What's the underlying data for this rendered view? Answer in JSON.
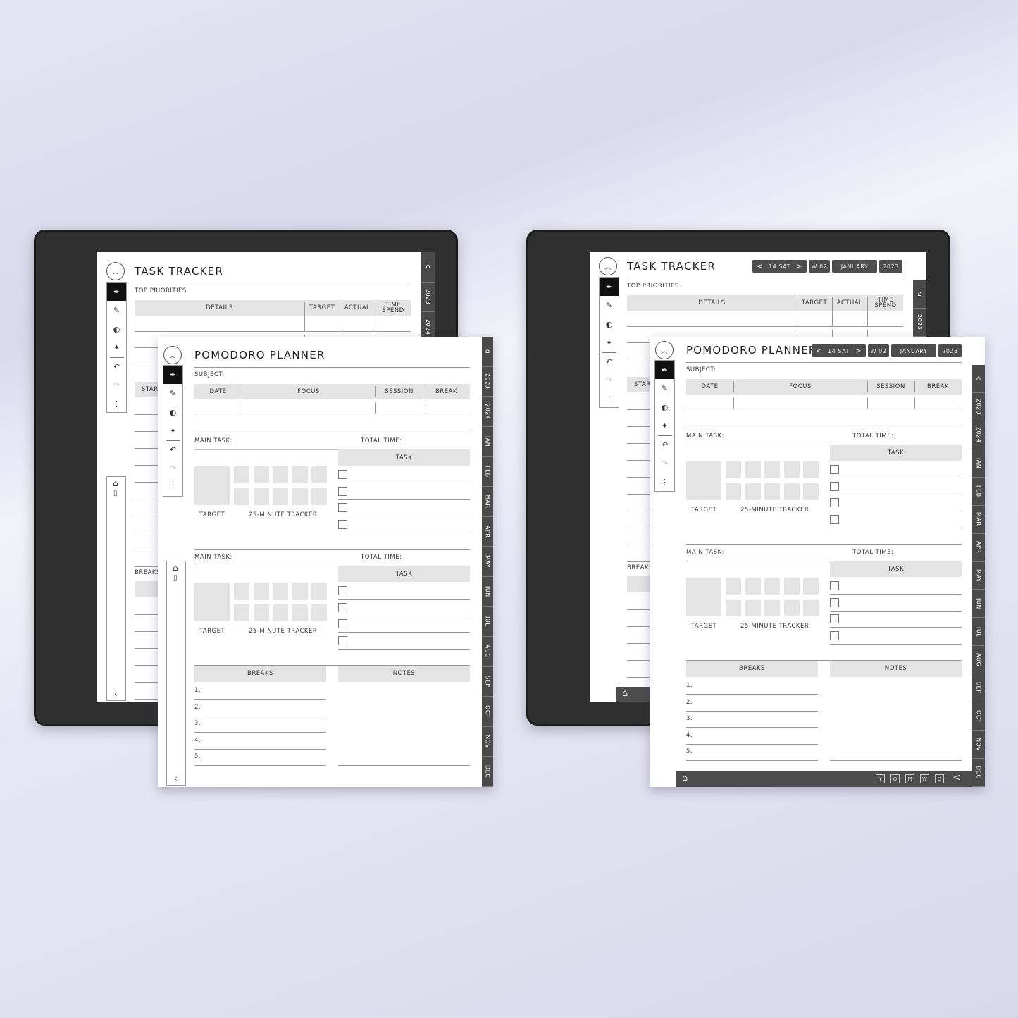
{
  "tabs": [
    "2023",
    "2024",
    "JAN",
    "FEB",
    "MAR",
    "APR",
    "MAY",
    "JUN",
    "JUL",
    "AUG",
    "SEP",
    "OCT",
    "NOV",
    "DEC"
  ],
  "task_tracker": {
    "title": "TASK TRACKER",
    "top_priorities": "TOP PRIORITIES",
    "columns": [
      "DETAILS",
      "TARGET",
      "ACTUAL",
      "TIME SPEND"
    ],
    "start_partial": "STAR",
    "breaks_partial": "BREAKS"
  },
  "pomodoro": {
    "title": "POMODORO PLANNER",
    "subject": "SUBJECT:",
    "columns": [
      "DATE",
      "FOCUS",
      "SESSION",
      "BREAK"
    ],
    "main_task": "MAIN TASK:",
    "total_time": "TOTAL TIME:",
    "task": "TASK",
    "target": "TARGET",
    "tracker": "25-MINUTE TRACKER",
    "breaks": "BREAKS",
    "notes": "NOTES",
    "break_numbers": [
      "1.",
      "2.",
      "3.",
      "4.",
      "5."
    ]
  },
  "header_nav": {
    "prev": "<",
    "day": "14 SAT",
    "next": ">",
    "week": "W 02",
    "month": "JANUARY",
    "year": "2023"
  },
  "bottom_nav": {
    "items": [
      "Y",
      "Q",
      "M",
      "W",
      "D"
    ],
    "back": "<"
  },
  "toolbar": {
    "collapse": "^",
    "undo": "↶",
    "redo": "↷",
    "more": "⋮"
  },
  "icons": [
    "home-icon",
    "page-icon",
    "pen-icon",
    "marker-icon",
    "eraser-icon",
    "lasso-icon",
    "undo-icon",
    "redo-icon",
    "more-icon",
    "chevron-up-icon",
    "chevron-left-icon",
    "calendar-icon"
  ],
  "colors": {
    "tab_strip": "#4a4a4a",
    "header_fill": "#e4e4e4",
    "bezel": "#2f2f2f"
  }
}
